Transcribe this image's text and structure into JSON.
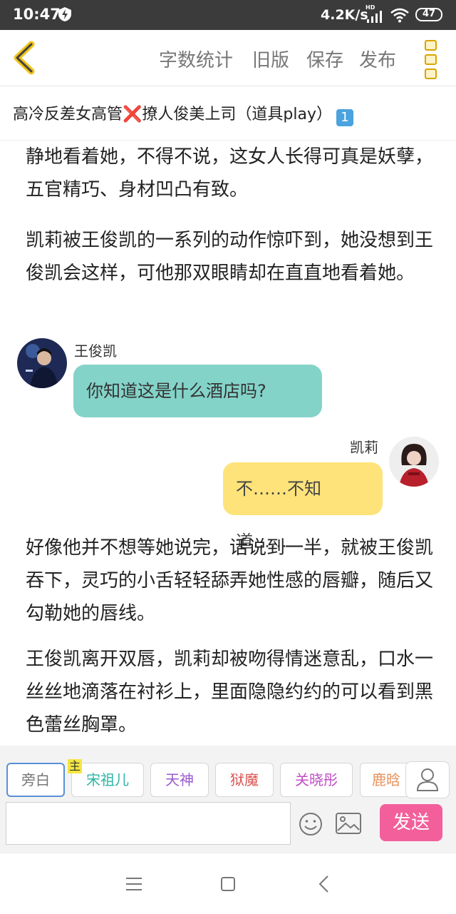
{
  "status_bar": {
    "time": "10:47",
    "net_speed": "4.2K/s",
    "hd_label": "HD",
    "battery": "47",
    "icons": [
      "charging-shield-icon",
      "signal-icon",
      "wifi-icon",
      "battery-icon"
    ]
  },
  "toolbar": {
    "back_icon": "chevron-left-icon",
    "word_count": "字数统计",
    "old_version": "旧版",
    "save": "保存",
    "publish": "发布",
    "more_icon": "vertical-dots-icon",
    "accent_color": "#d9a400"
  },
  "story": {
    "title_prefix": "高冷反差女高管",
    "title_cross": "❌",
    "title_suffix": "撩人俊美上司（道具play）",
    "title_badge": "1"
  },
  "content": {
    "paragraphs": [
      "静地看着她，不得不说，这女人长得可真是妖孽，五官精巧、身材凹凸有致。",
      "凯莉被王俊凯的一系列的动作惊吓到，她没想到王俊凯会这样，可他那双眼睛却在直直地看着她。",
      "好像他并不想等她说完，话说到一半，就被王俊凯吞下，灵巧的小舌轻轻舔弄她性感的唇瓣，随后又勾勒她的唇线。",
      "王俊凯离开双唇，凯莉却被吻得情迷意乱，口水一丝丝地滴落在衬衫上，里面隐隐约约的可以看到黑色蕾丝胸罩。"
    ],
    "messages": [
      {
        "speaker": "王俊凯",
        "text": "你知道这是什么酒店吗?",
        "side": "left",
        "color": "#84d3c9"
      },
      {
        "speaker": "凯莉",
        "text": "不……不知道……",
        "side": "right",
        "color": "#fde37a"
      }
    ]
  },
  "roles": {
    "chips": [
      {
        "label": "旁白",
        "color": "#777777"
      },
      {
        "label": "宋祖儿",
        "color": "#2bb5a6",
        "badge": "主"
      },
      {
        "label": "天神",
        "color": "#9b59d0"
      },
      {
        "label": "狱魔",
        "color": "#d9534f"
      },
      {
        "label": "关晓彤",
        "color": "#c04fc4"
      },
      {
        "label": "鹿晗",
        "color": "#e8915a"
      }
    ],
    "user_icon": "user-icon",
    "input_value": "",
    "emoji_icon": "smiley-icon",
    "image_icon": "image-icon",
    "send": "发送",
    "send_color": "#f25f9b"
  },
  "nav": {
    "icons": [
      "menu-icon",
      "home-square-icon",
      "back-triangle-icon"
    ]
  }
}
